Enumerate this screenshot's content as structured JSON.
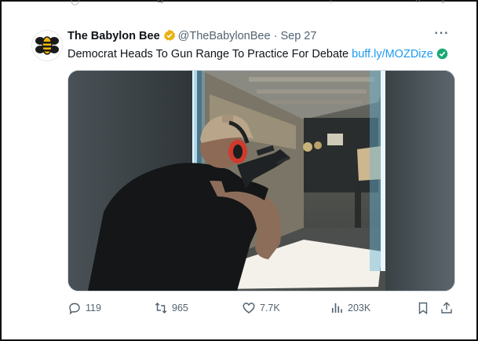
{
  "tweet": {
    "author_name": "The Babylon Bee",
    "handle": "@TheBabylonBee",
    "separator": "·",
    "date": "Sep 27",
    "text": "Democrat Heads To Gun Range To Practice For Debate",
    "link": "buff.ly/MOZDize",
    "more_label": "···",
    "stats": {
      "replies": "119",
      "reposts": "965",
      "likes": "7.7K",
      "views": "203K"
    }
  },
  "icons": [
    "verified-badge-icon",
    "more-icon",
    "reply-icon",
    "repost-icon",
    "like-icon",
    "views-icon",
    "bookmark-icon",
    "share-icon",
    "check-mark-icon"
  ],
  "colors": {
    "link": "#1d9bf0",
    "muted": "#536471",
    "verified_gold": "#e8b10e",
    "check_green": "#19a974"
  }
}
